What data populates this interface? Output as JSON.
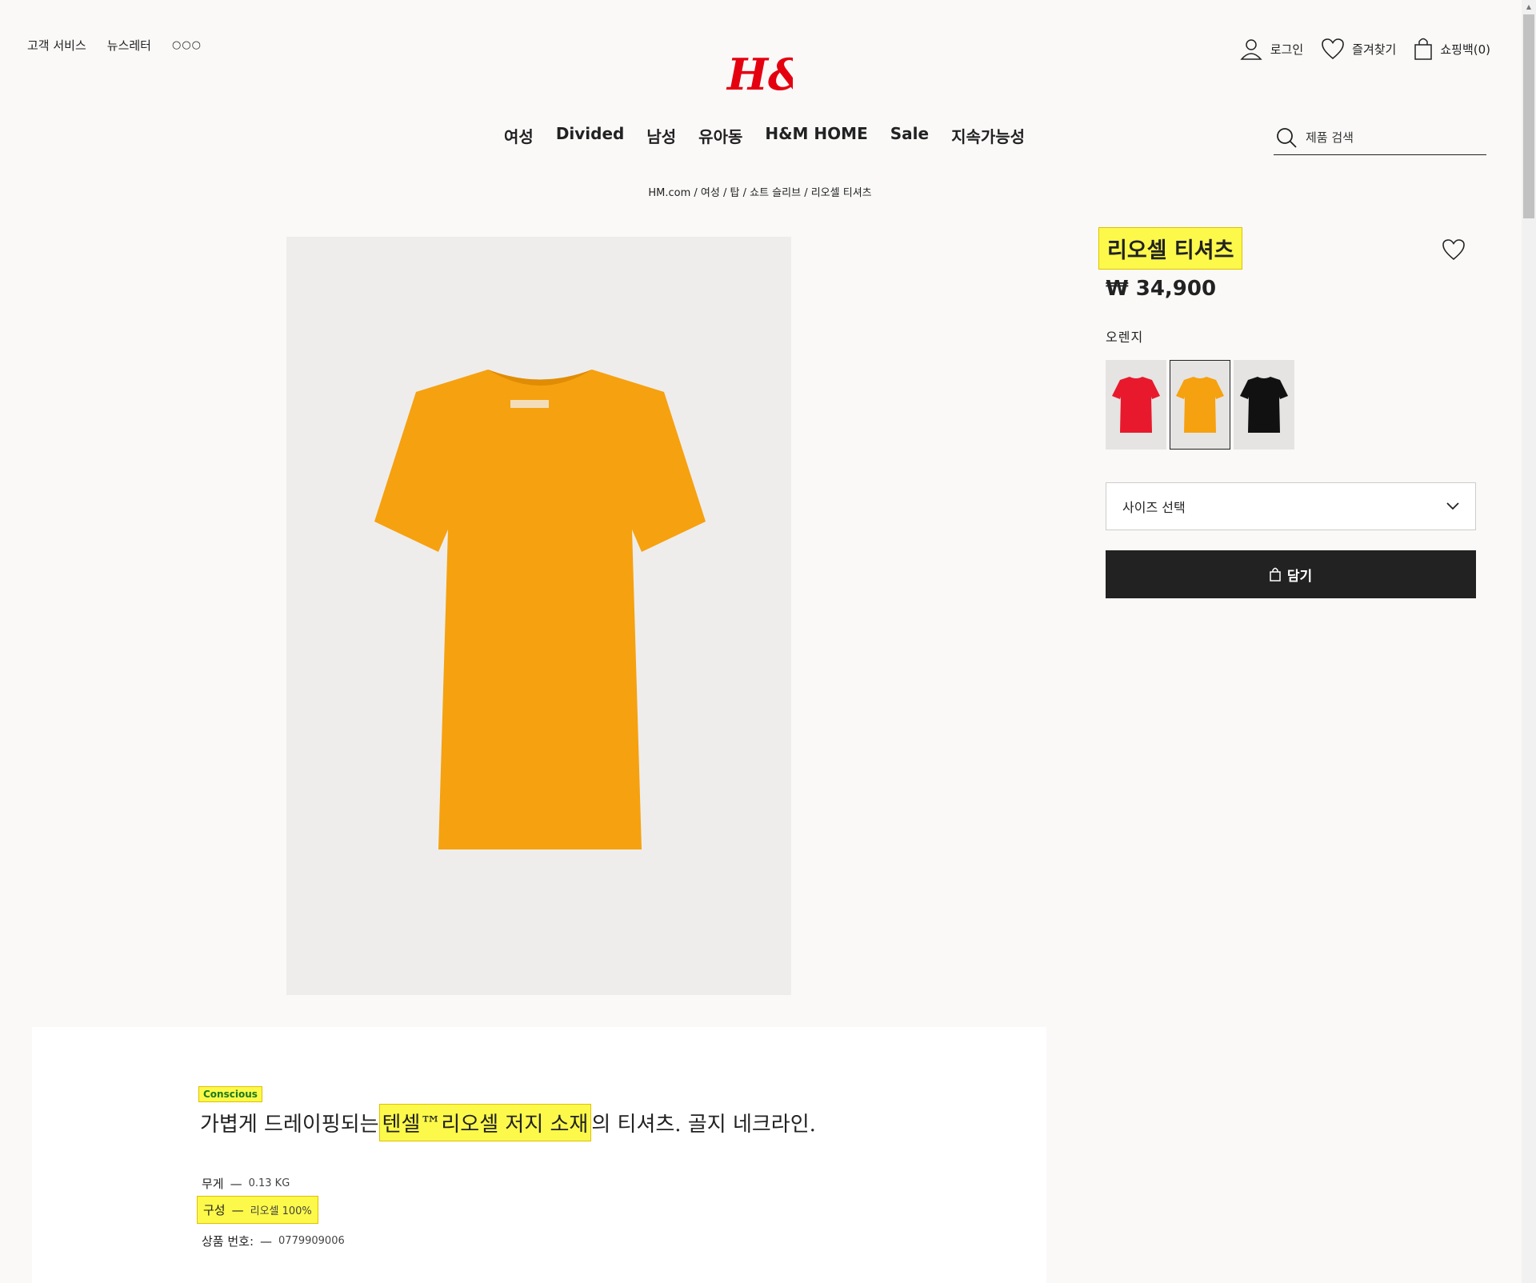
{
  "util_left": {
    "customer_service": "고객 서비스",
    "newsletter": "뉴스레터",
    "more": "○○○"
  },
  "logo": {
    "text": "H&M",
    "color": "#e50010"
  },
  "util_right": {
    "login": "로그인",
    "favorites": "즐겨찾기",
    "bag": "쇼핑백(0)"
  },
  "nav": {
    "items": [
      "여성",
      "Divided",
      "남성",
      "유아동",
      "H&M HOME",
      "Sale",
      "지속가능성"
    ]
  },
  "search": {
    "placeholder": "제품 검색"
  },
  "breadcrumb": {
    "items": [
      "HM.com",
      "여성",
      "탑",
      "쇼트 슬리브",
      "리오셀 티셔츠"
    ],
    "separator": " / "
  },
  "product": {
    "title": "리오셀 티셔츠",
    "price": "₩ 34,900",
    "color_name": "오렌지",
    "swatches": [
      {
        "name": "red",
        "color": "#e8192c"
      },
      {
        "name": "orange",
        "color": "#f6a10f"
      },
      {
        "name": "black",
        "color": "#111111"
      }
    ],
    "selected_swatch": "orange",
    "size_select": "사이즈 선택",
    "add_to_bag": "담기",
    "image_color": "#f6a10f"
  },
  "description": {
    "badge": "Conscious",
    "text_before": "가볍게 드레이핑되는 ",
    "text_highlight": "텐셀™리오셀 저지 소재",
    "text_after": "의 티셔츠. 골지 네크라인.",
    "specs": [
      {
        "label": "무게",
        "value": "0.13 KG"
      },
      {
        "label": "구성",
        "value": "리오셀 100%"
      },
      {
        "label": "상품 번호:",
        "value": "0779909006"
      }
    ]
  },
  "highlight_color": "#fcf94a"
}
